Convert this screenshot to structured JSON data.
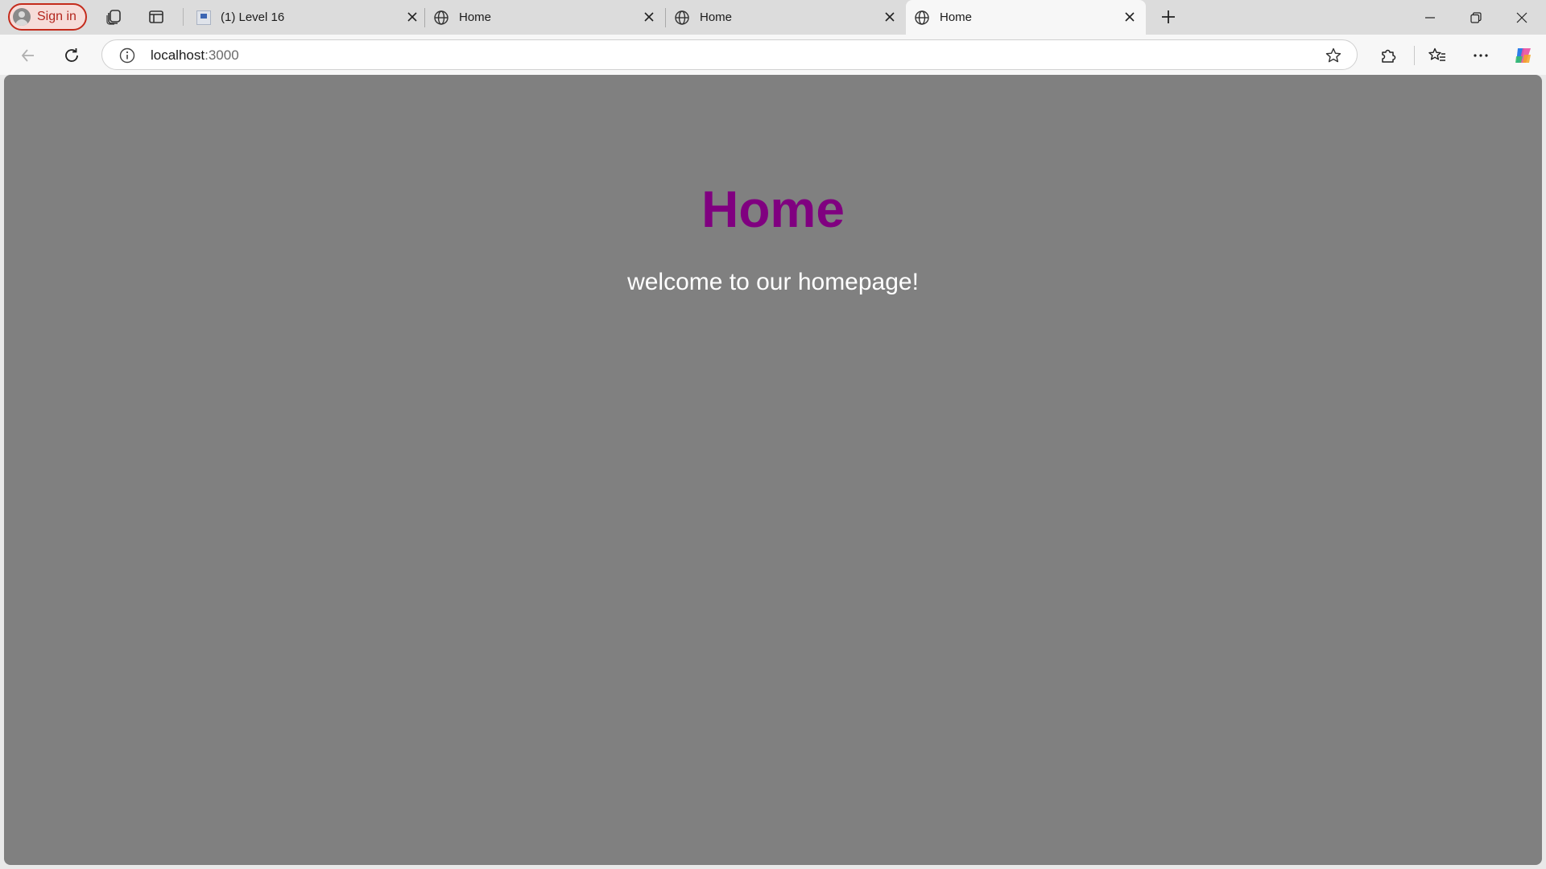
{
  "browser": {
    "signin_label": "Sign in",
    "tabs": [
      {
        "title": "(1) Level 16",
        "favicon": "app-favicon",
        "active": false
      },
      {
        "title": "Home",
        "favicon": "globe-icon",
        "active": false
      },
      {
        "title": "Home",
        "favicon": "globe-icon",
        "active": false
      },
      {
        "title": "Home",
        "favicon": "globe-icon",
        "active": true
      }
    ],
    "address": {
      "host": "localhost",
      "port": ":3000"
    }
  },
  "page": {
    "title": "Home",
    "subtitle": "welcome to our homepage!",
    "background": "#808080",
    "title_color": "#800080",
    "text_color": "#ffffff"
  }
}
